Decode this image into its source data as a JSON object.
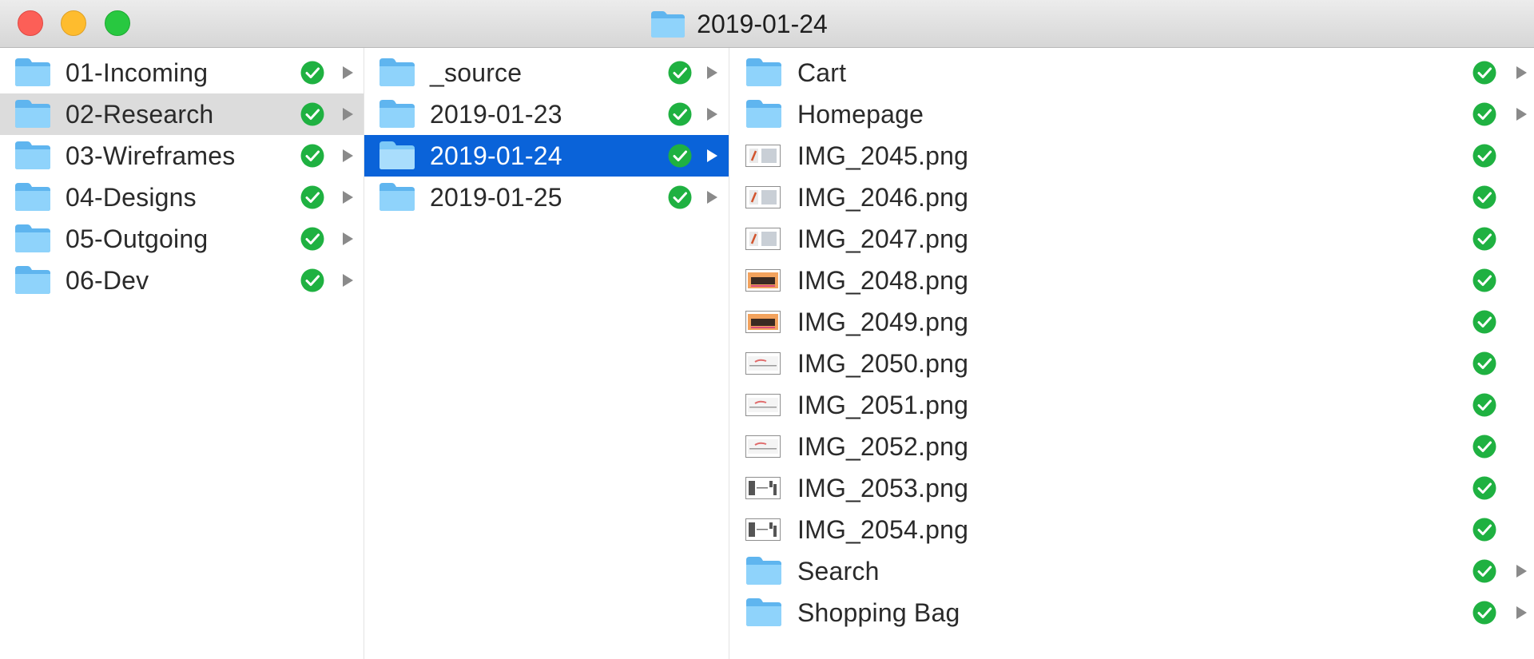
{
  "window": {
    "title": "2019-01-24",
    "title_icon": "folder-icon"
  },
  "colors": {
    "selection": "#0a63d9",
    "path_selection": "#dcdcdc",
    "folder": "#6cc3f5",
    "status_green": "#1fb141"
  },
  "columns": [
    {
      "items": [
        {
          "label": "01-Incoming",
          "type": "folder",
          "state": "normal"
        },
        {
          "label": "02-Research",
          "type": "folder",
          "state": "path"
        },
        {
          "label": "03-Wireframes",
          "type": "folder",
          "state": "normal"
        },
        {
          "label": "04-Designs",
          "type": "folder",
          "state": "normal"
        },
        {
          "label": "05-Outgoing",
          "type": "folder",
          "state": "normal"
        },
        {
          "label": "06-Dev",
          "type": "folder",
          "state": "normal"
        }
      ]
    },
    {
      "items": [
        {
          "label": "_source",
          "type": "folder",
          "state": "normal"
        },
        {
          "label": "2019-01-23",
          "type": "folder",
          "state": "normal"
        },
        {
          "label": "2019-01-24",
          "type": "folder",
          "state": "selected"
        },
        {
          "label": "2019-01-25",
          "type": "folder",
          "state": "normal"
        }
      ]
    },
    {
      "items": [
        {
          "label": "Cart",
          "type": "folder",
          "state": "normal"
        },
        {
          "label": "Homepage",
          "type": "folder",
          "state": "normal"
        },
        {
          "label": "IMG_2045.png",
          "type": "image",
          "thumb": "a",
          "state": "normal"
        },
        {
          "label": "IMG_2046.png",
          "type": "image",
          "thumb": "a",
          "state": "normal"
        },
        {
          "label": "IMG_2047.png",
          "type": "image",
          "thumb": "a",
          "state": "normal"
        },
        {
          "label": "IMG_2048.png",
          "type": "image",
          "thumb": "b",
          "state": "normal"
        },
        {
          "label": "IMG_2049.png",
          "type": "image",
          "thumb": "b",
          "state": "normal"
        },
        {
          "label": "IMG_2050.png",
          "type": "image",
          "thumb": "c",
          "state": "normal"
        },
        {
          "label": "IMG_2051.png",
          "type": "image",
          "thumb": "c",
          "state": "normal"
        },
        {
          "label": "IMG_2052.png",
          "type": "image",
          "thumb": "c",
          "state": "normal"
        },
        {
          "label": "IMG_2053.png",
          "type": "image",
          "thumb": "d",
          "state": "normal"
        },
        {
          "label": "IMG_2054.png",
          "type": "image",
          "thumb": "d",
          "state": "normal"
        },
        {
          "label": "Search",
          "type": "folder",
          "state": "normal"
        },
        {
          "label": "Shopping Bag",
          "type": "folder",
          "state": "normal"
        }
      ]
    }
  ]
}
